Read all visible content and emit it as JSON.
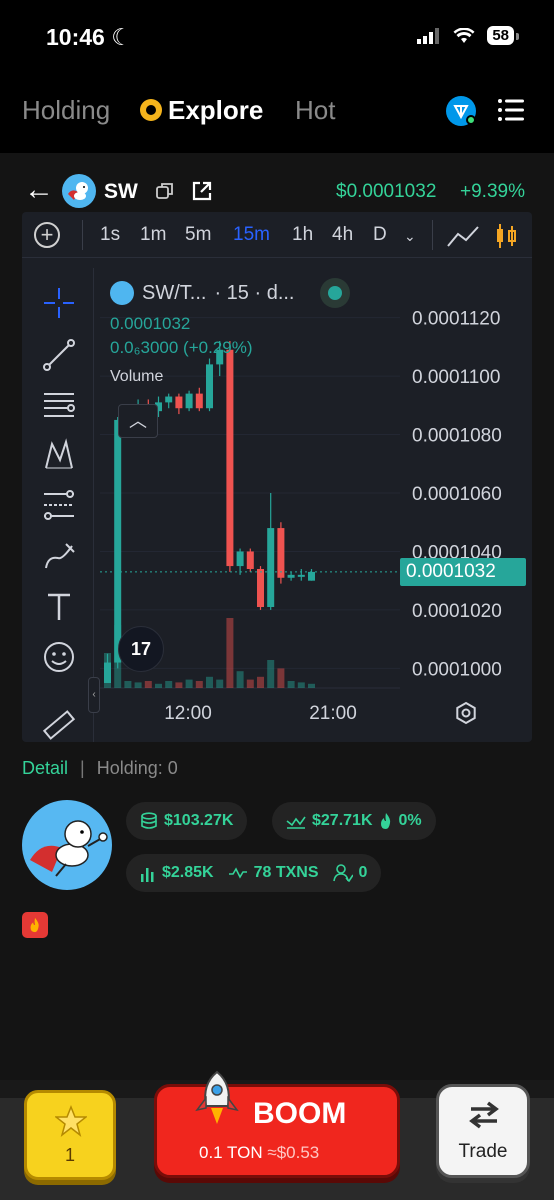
{
  "status": {
    "time": "10:46",
    "battery": "58"
  },
  "nav": {
    "tabs": [
      "Holding",
      "Explore",
      "Hot"
    ],
    "active": "Explore"
  },
  "token": {
    "symbol": "SW",
    "price": "$0.0001032",
    "change": "+9.39%"
  },
  "chart": {
    "timeframes": [
      "1s",
      "1m",
      "5m",
      "15m",
      "1h",
      "4h",
      "D"
    ],
    "active_timeframe": "15m",
    "legend_title": "SW/T...",
    "legend_interval": "· 15 · d...",
    "legend_price": "0.0001032",
    "legend_change": "0.0₆3000 (+0.29%)",
    "volume_label": "Volume",
    "tv_logo": "17",
    "current_price_tag": "0.0001032"
  },
  "chart_data": {
    "type": "candlestick",
    "y_ticks": [
      "0.0001120",
      "0.0001100",
      "0.0001080",
      "0.0001060",
      "0.0001040",
      "0.0001020",
      "0.0001000"
    ],
    "x_ticks": [
      "12:00",
      "21:00"
    ],
    "ylim": [
      9.95e-05,
      0.0001125
    ],
    "candles": [
      {
        "o": 9.95e-05,
        "h": 0.0001005,
        "l": 9.95e-05,
        "c": 0.0001002
      },
      {
        "o": 0.0001002,
        "h": 0.0001086,
        "l": 0.0001,
        "c": 0.0001085
      },
      {
        "o": 0.0001085,
        "h": 0.000109,
        "l": 0.0001083,
        "c": 0.0001087
      },
      {
        "o": 0.0001087,
        "h": 0.0001092,
        "l": 0.0001085,
        "c": 0.000109
      },
      {
        "o": 0.000109,
        "h": 0.0001092,
        "l": 0.0001086,
        "c": 0.0001088
      },
      {
        "o": 0.0001088,
        "h": 0.0001093,
        "l": 0.0001086,
        "c": 0.0001091
      },
      {
        "o": 0.0001091,
        "h": 0.0001094,
        "l": 0.0001089,
        "c": 0.0001093
      },
      {
        "o": 0.0001093,
        "h": 0.0001094,
        "l": 0.0001087,
        "c": 0.0001089
      },
      {
        "o": 0.0001089,
        "h": 0.0001095,
        "l": 0.0001088,
        "c": 0.0001094
      },
      {
        "o": 0.0001094,
        "h": 0.0001096,
        "l": 0.0001088,
        "c": 0.0001089
      },
      {
        "o": 0.0001089,
        "h": 0.0001106,
        "l": 0.0001088,
        "c": 0.0001104
      },
      {
        "o": 0.0001104,
        "h": 0.0001112,
        "l": 0.00011,
        "c": 0.0001109
      },
      {
        "o": 0.0001109,
        "h": 0.0001112,
        "l": 0.0001033,
        "c": 0.0001035
      },
      {
        "o": 0.0001035,
        "h": 0.0001041,
        "l": 0.0001032,
        "c": 0.000104
      },
      {
        "o": 0.000104,
        "h": 0.0001041,
        "l": 0.0001033,
        "c": 0.0001034
      },
      {
        "o": 0.0001034,
        "h": 0.0001035,
        "l": 0.000102,
        "c": 0.0001021
      },
      {
        "o": 0.0001021,
        "h": 0.000106,
        "l": 0.000102,
        "c": 0.0001048
      },
      {
        "o": 0.0001048,
        "h": 0.000105,
        "l": 0.0001029,
        "c": 0.0001031
      },
      {
        "o": 0.0001031,
        "h": 0.0001033,
        "l": 0.000103,
        "c": 0.0001032
      },
      {
        "o": 0.0001032,
        "h": 0.0001034,
        "l": 0.000103,
        "c": 0.0001032
      },
      {
        "o": 0.000103,
        "h": 0.0001034,
        "l": 0.000103,
        "c": 0.0001033
      }
    ],
    "volumes": [
      0.25,
      0.45,
      0.05,
      0.04,
      0.05,
      0.03,
      0.05,
      0.04,
      0.06,
      0.05,
      0.08,
      0.06,
      0.5,
      0.12,
      0.06,
      0.08,
      0.2,
      0.14,
      0.05,
      0.04,
      0.03
    ]
  },
  "detail": {
    "tab_detail": "Detail",
    "tab_holding": "Holding: 0",
    "market_cap": "$103.27K",
    "liquidity": "$27.71K",
    "fire_pct": "0%",
    "volume": "$2.85K",
    "txns": "78 TXNS",
    "holders": "0"
  },
  "actions": {
    "star_count": "1",
    "boom_label": "BOOM",
    "boom_amount": "0.1 TON",
    "boom_usd": "≈$0.53",
    "trade_label": "Trade"
  },
  "colors": {
    "accent_green": "#34d399",
    "candle_up": "#26a69a",
    "candle_down": "#ef5350",
    "boom_red": "#f0261e",
    "star_yellow": "#f7d21e"
  }
}
